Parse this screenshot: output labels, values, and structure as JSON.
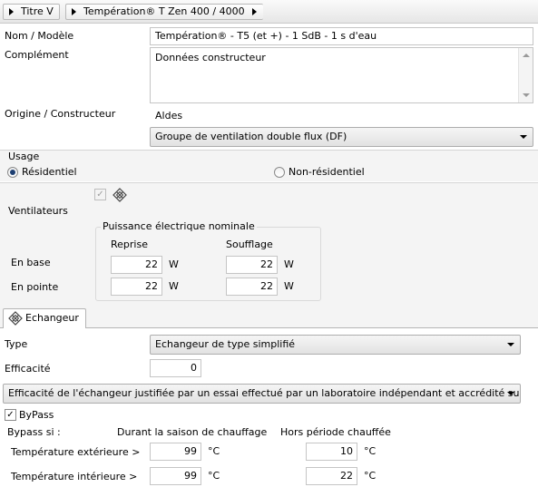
{
  "breadcrumb": {
    "items": [
      "Titre V",
      "Températion®  T Zen 400 / 4000"
    ]
  },
  "identity": {
    "name_label": "Nom / Modèle",
    "name_value": "Températion®  - T5 (et +) - 1 SdB - 1 s d'eau",
    "complement_label": "Complément",
    "complement_value": "Données constructeur",
    "origin_label": "Origine / Constructeur",
    "origin_value": "Aldes",
    "system_type": "Groupe de ventilation double flux (DF)"
  },
  "usage": {
    "label": "Usage",
    "residential": "Résidentiel",
    "non_residential": "Non-résidentiel",
    "selected": "Résidentiel"
  },
  "ventilators": {
    "label": "Ventilateurs",
    "power_group": "Puissance électrique nominale",
    "col_reprise": "Reprise",
    "col_soufflage": "Soufflage",
    "row_base": "En base",
    "row_pointe": "En pointe",
    "base_reprise": "22",
    "base_soufflage": "22",
    "pointe_reprise": "22",
    "pointe_soufflage": "22",
    "unit": "W"
  },
  "exchanger": {
    "tab_label": "Echangeur",
    "type_label": "Type",
    "type_value": "Echangeur de type simplifié",
    "efficiency_label": "Efficacité",
    "efficiency_value": "0",
    "justification": "Efficacité de l'échangeur justifiée par un essai effectué par un laboratoire indépendant et accrédité sur la",
    "bypass_label": "ByPass",
    "bypass_checked": true,
    "bypass_if": "Bypass si :",
    "col_heating": "Durant la saison de chauffage",
    "col_off": "Hors période chauffée",
    "ext_label": "Température extérieure >",
    "int_label": "Température intérieure >",
    "ext_heating": "99",
    "ext_off": "10",
    "int_heating": "99",
    "int_off": "22",
    "temp_unit": "°C"
  },
  "colors": {
    "radio_dot": "#1e3f72",
    "border": "#c5c5c5"
  }
}
